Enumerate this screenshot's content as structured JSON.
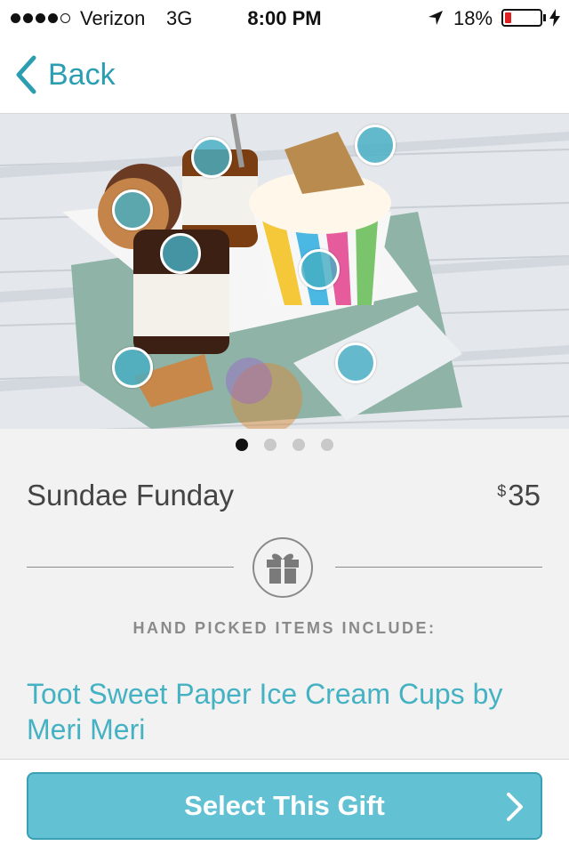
{
  "status_bar": {
    "carrier": "Verizon",
    "network": "3G",
    "time": "8:00 PM",
    "battery_percent": "18%",
    "battery_level": 0.18,
    "signal_bars": 4,
    "signal_total": 5
  },
  "nav": {
    "back_label": "Back"
  },
  "gallery": {
    "page_count": 4,
    "active_page": 1
  },
  "product": {
    "title": "Sundae Funday",
    "currency": "$",
    "price": "35"
  },
  "section": {
    "subtitle": "HAND PICKED ITEMS INCLUDE:",
    "icon": "gift-icon"
  },
  "items": [
    {
      "label": "Toot Sweet Paper Ice Cream Cups by Meri Meri"
    }
  ],
  "footer": {
    "select_label": "Select This Gift"
  },
  "colors": {
    "accent": "#45b2c4",
    "button_bg": "#62c1d2",
    "battery_low": "#e02020"
  }
}
